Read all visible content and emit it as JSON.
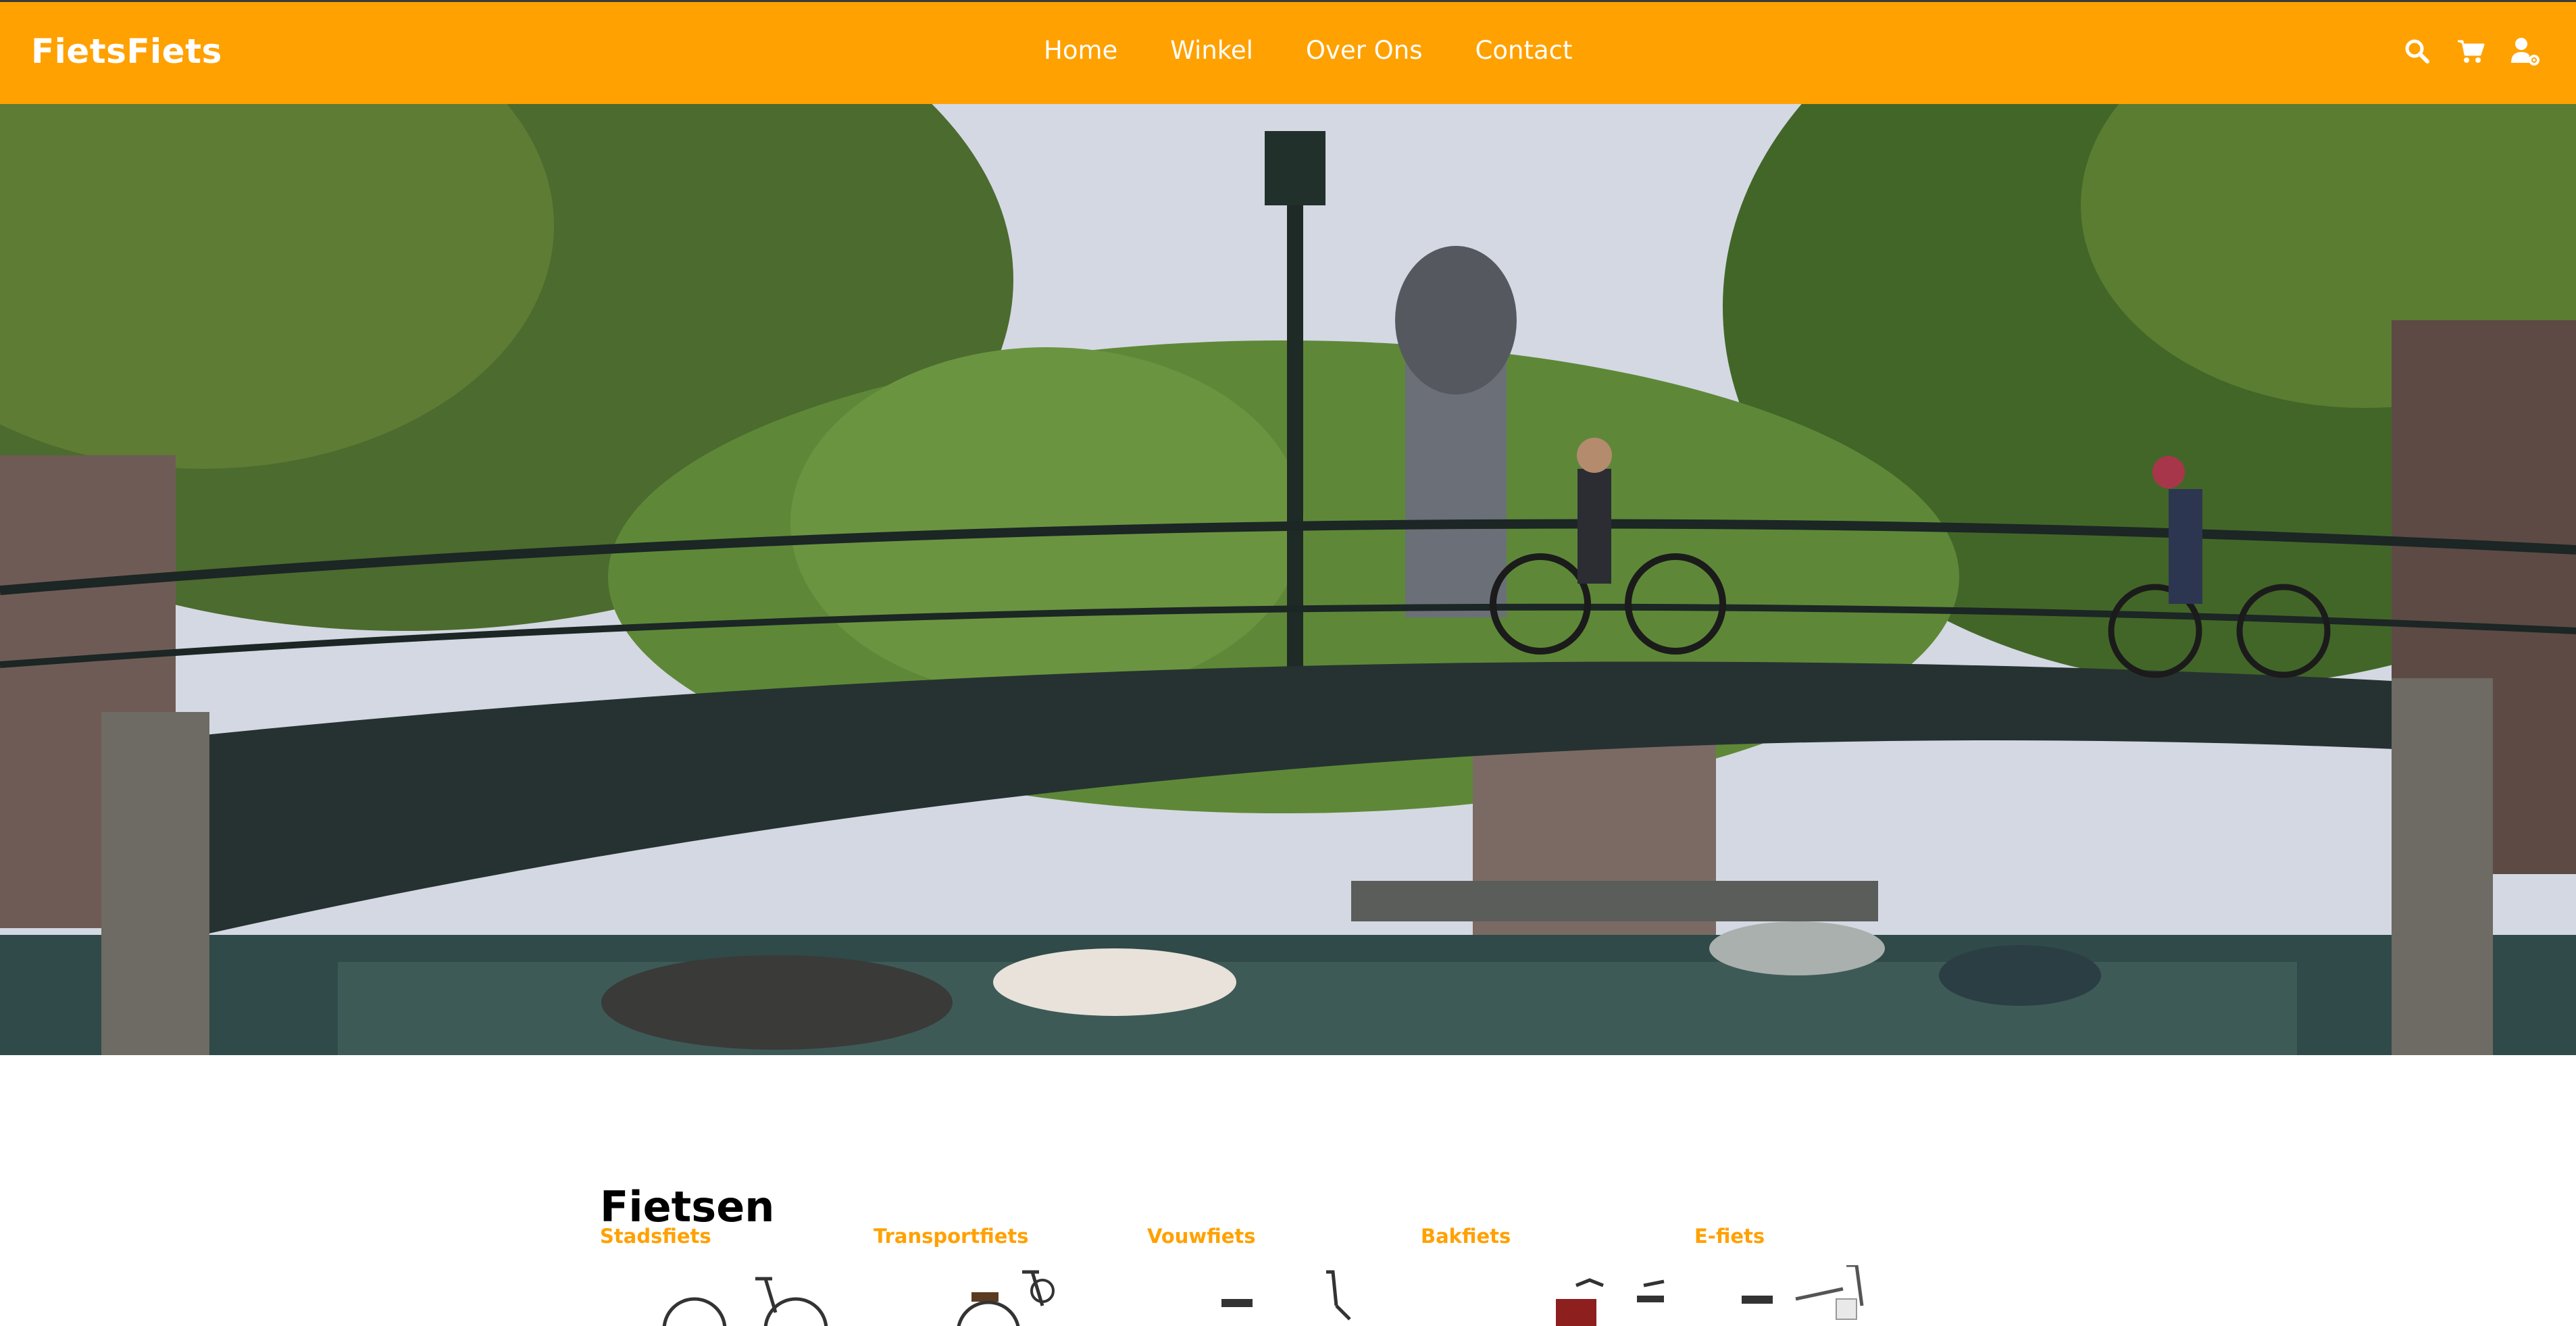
{
  "header": {
    "brand": "FietsFiets",
    "nav": [
      {
        "label": "Home"
      },
      {
        "label": "Winkel"
      },
      {
        "label": "Over Ons"
      },
      {
        "label": "Contact"
      }
    ],
    "icons": [
      "search-icon",
      "cart-icon",
      "user-settings-icon"
    ]
  },
  "hero": {
    "image": "canal-bridge-with-cyclists-photo"
  },
  "main": {
    "title": "Fietsen",
    "categories": [
      {
        "label": "Stadsfiets"
      },
      {
        "label": "Transportfiets"
      },
      {
        "label": "Vouwfiets"
      },
      {
        "label": "Bakfiets"
      },
      {
        "label": "E-fiets"
      }
    ]
  },
  "colors": {
    "accent": "#ffa101",
    "nav_text": "#ffffff",
    "title": "#000000"
  }
}
